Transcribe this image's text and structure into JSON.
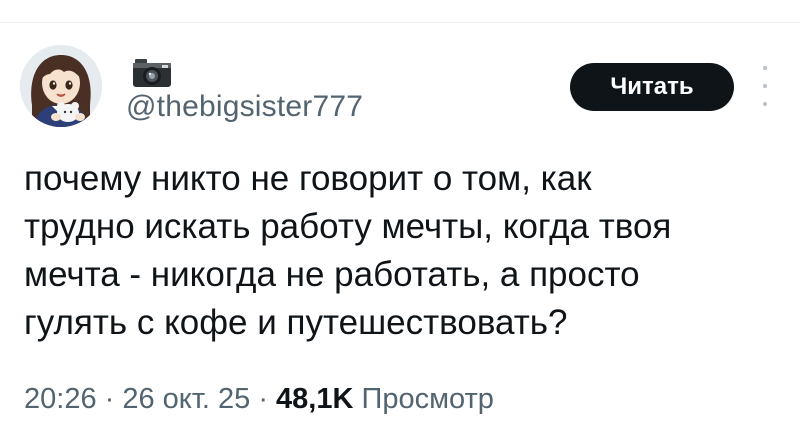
{
  "author": {
    "name_emoji": "📷",
    "handle": "@thebigsister777"
  },
  "actions": {
    "follow_label": "Читать"
  },
  "tweet": {
    "text": "почему никто не говорит о том, как\nтрудно искать работу мечты, когда твоя\nмечта - никогда не работать, а просто\nгулять с кофе и путешествовать?"
  },
  "meta": {
    "time": "20:26",
    "separator1": " · ",
    "date": "26 окт. 25",
    "separator2": " · ",
    "views_count": "48,1K",
    "views_label": " Просмотр"
  },
  "icons": {
    "name_emoji_icon": "camera-icon",
    "more_icon": "more-options-icon"
  },
  "colors": {
    "text_primary": "#0f1419",
    "text_secondary": "#536471",
    "button_bg": "#0f1419",
    "button_text": "#ffffff"
  }
}
